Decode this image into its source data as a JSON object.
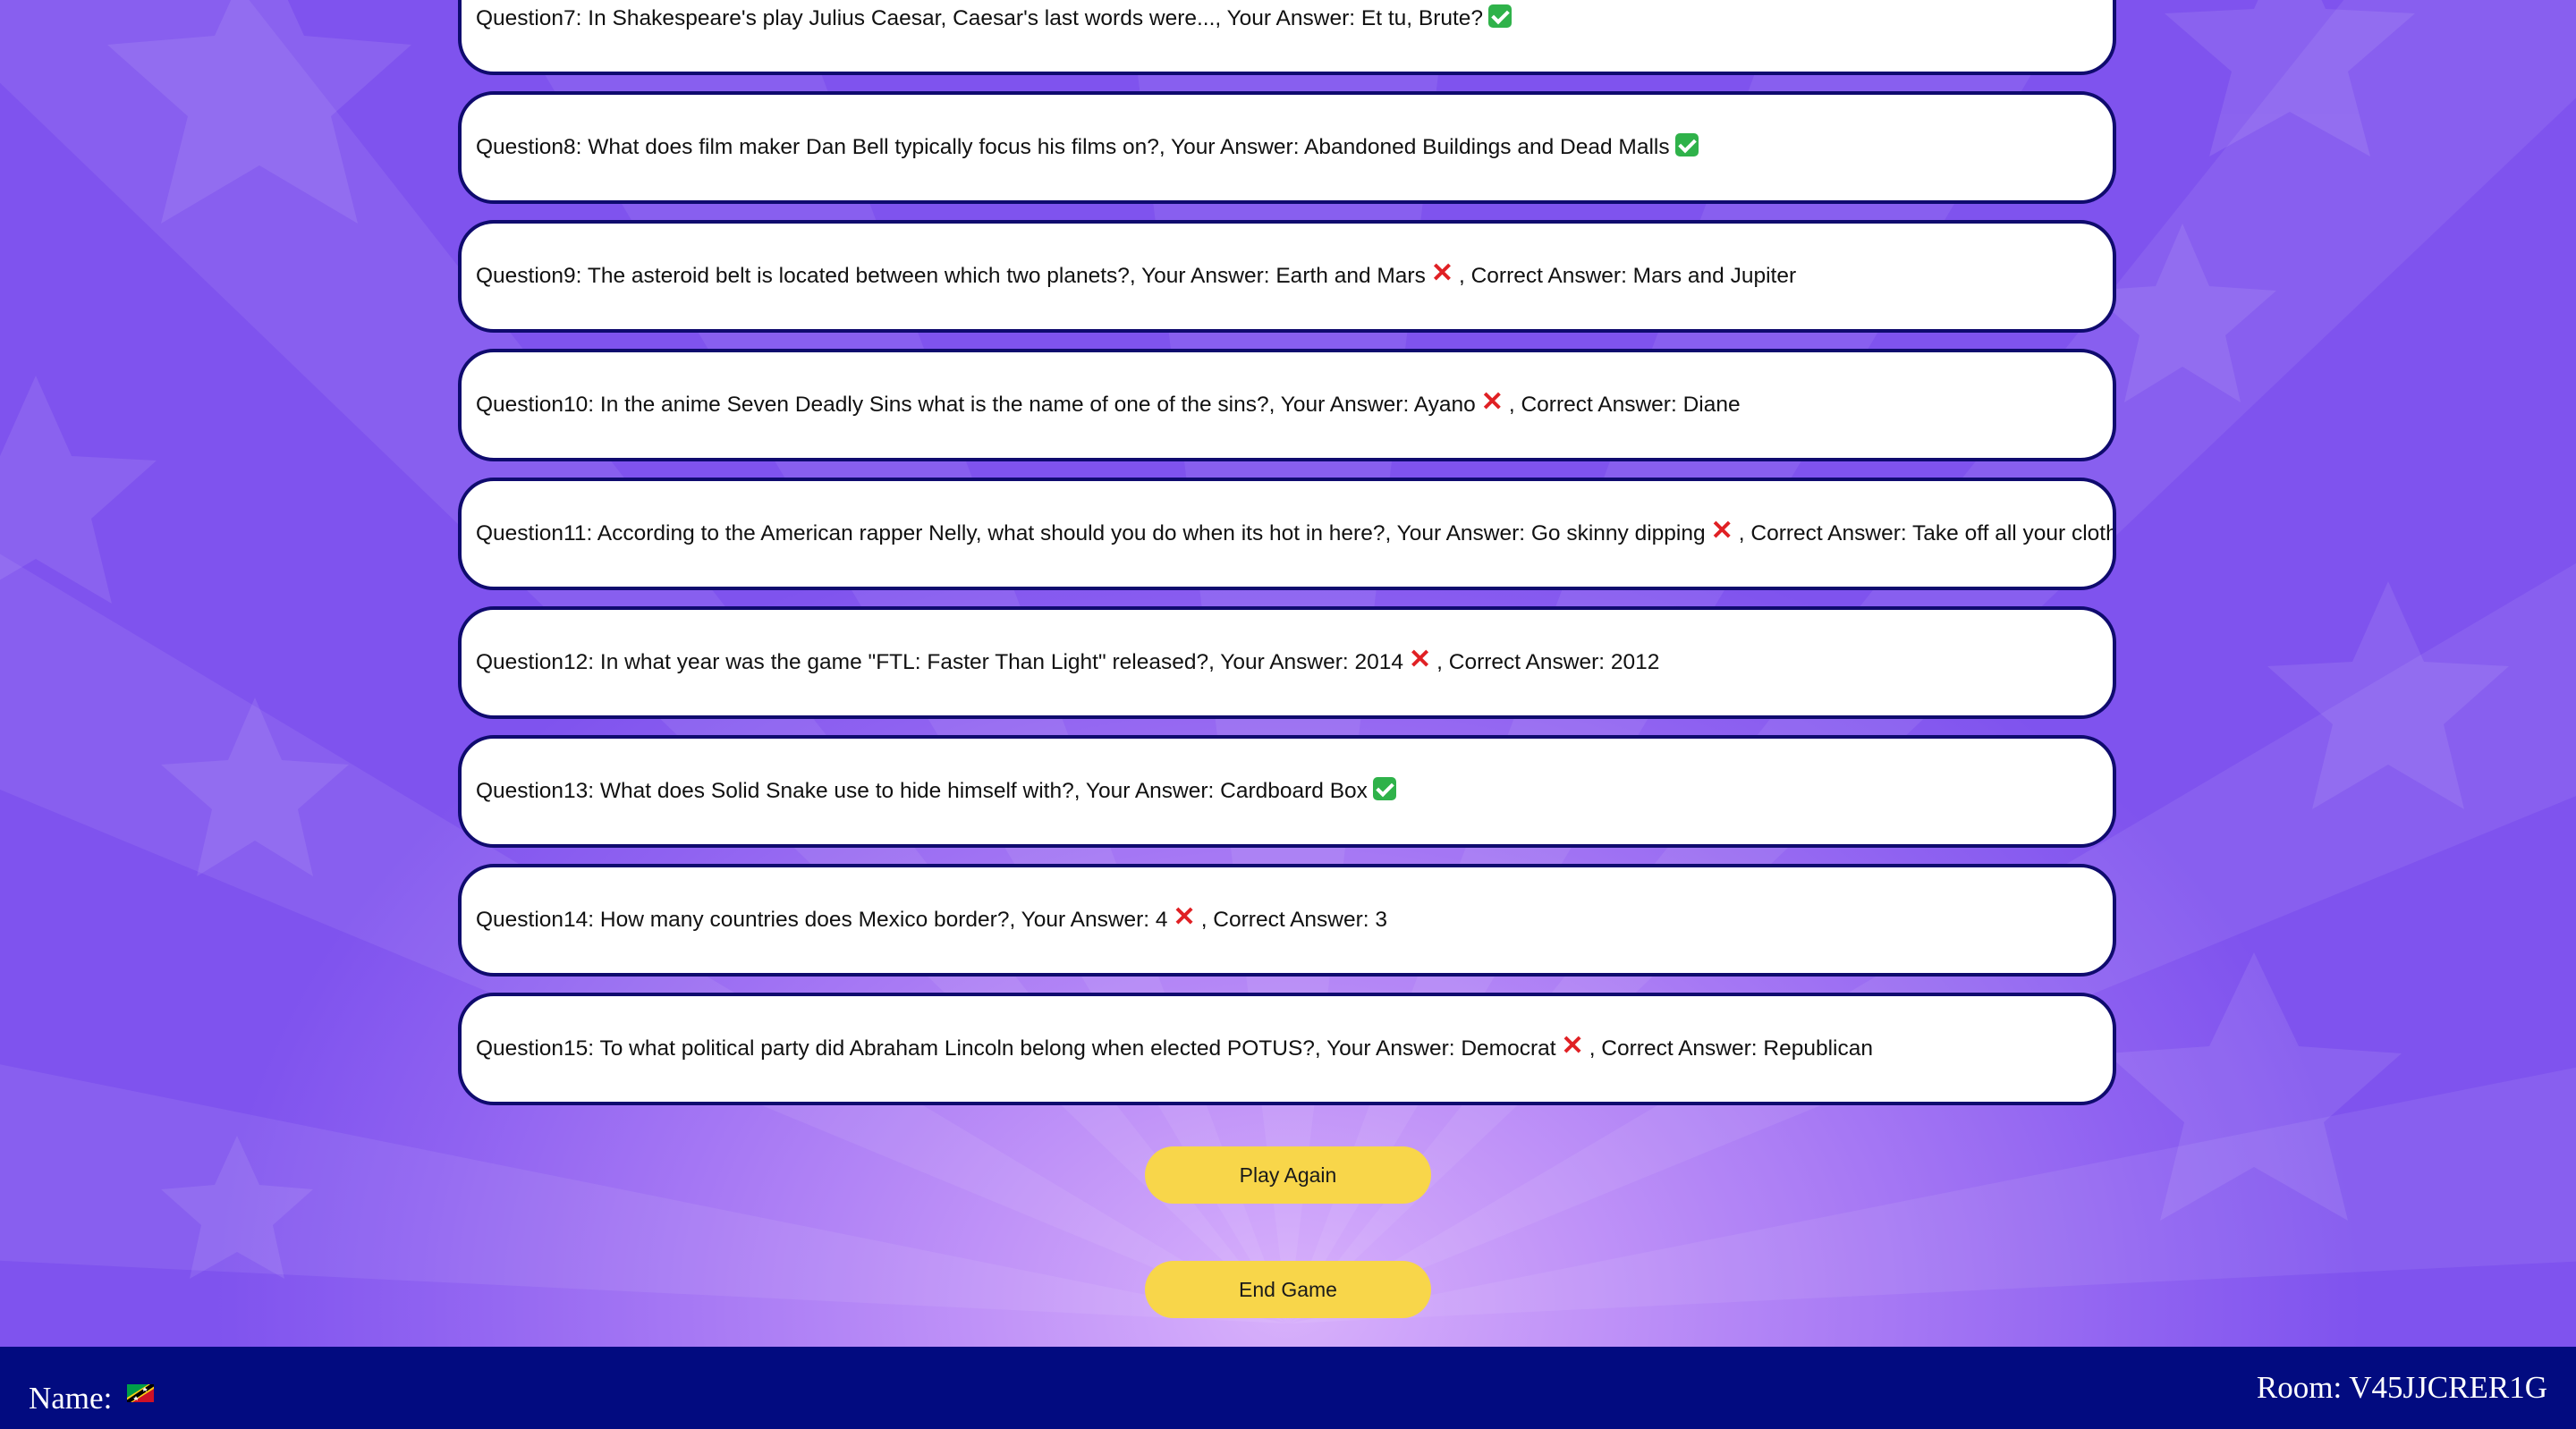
{
  "results": [
    {
      "prefix": "Question7: In Shakespeare's play Julius Caesar, Caesar's last words were..., Your Answer: Et tu, Brute?",
      "correct": true,
      "correct_answer_text": ""
    },
    {
      "prefix": "Question8: What does film maker Dan Bell typically focus his films on?, Your Answer: Abandoned Buildings and Dead Malls",
      "correct": true,
      "correct_answer_text": ""
    },
    {
      "prefix": "Question9: The asteroid belt is located between which two planets?, Your Answer: Earth and Mars",
      "correct": false,
      "correct_answer_text": ", Correct Answer: Mars and Jupiter"
    },
    {
      "prefix": "Question10: In the anime Seven Deadly Sins what is the name of one of the sins?, Your Answer: Ayano",
      "correct": false,
      "correct_answer_text": ", Correct Answer: Diane"
    },
    {
      "prefix": "Question11: According to the American rapper Nelly, what should you do when its hot in here?, Your Answer: Go skinny dipping",
      "correct": false,
      "correct_answer_text": ", Correct Answer: Take off all your clothes"
    },
    {
      "prefix": "Question12: In what year was the game \"FTL: Faster Than Light\" released?, Your Answer: 2014",
      "correct": false,
      "correct_answer_text": ", Correct Answer: 2012"
    },
    {
      "prefix": "Question13: What does Solid Snake use to hide himself with?, Your Answer: Cardboard Box",
      "correct": true,
      "correct_answer_text": ""
    },
    {
      "prefix": "Question14: How many countries does Mexico border?, Your Answer: 4",
      "correct": false,
      "correct_answer_text": ", Correct Answer: 3"
    },
    {
      "prefix": "Question15: To what political party did Abraham Lincoln belong when elected POTUS?, Your Answer: Democrat",
      "correct": false,
      "correct_answer_text": ", Correct Answer: Republican"
    }
  ],
  "marks": {
    "correct_icon": "check-mark-icon",
    "wrong_icon": "cross-mark-icon",
    "wrong_glyph": "✕"
  },
  "buttons": {
    "play_again": "Play Again",
    "end_game": "End Game"
  },
  "footer": {
    "name_label": "Name:",
    "flag_icon": "saint-kitts-and-nevis-flag-icon",
    "room_label": "Room: V45JJCRER1G"
  },
  "colors": {
    "card_border": "#0f0b6e",
    "button": "#f8d64a",
    "footer": "#020b80",
    "correct": "#2fb24a",
    "wrong": "#e02024"
  }
}
